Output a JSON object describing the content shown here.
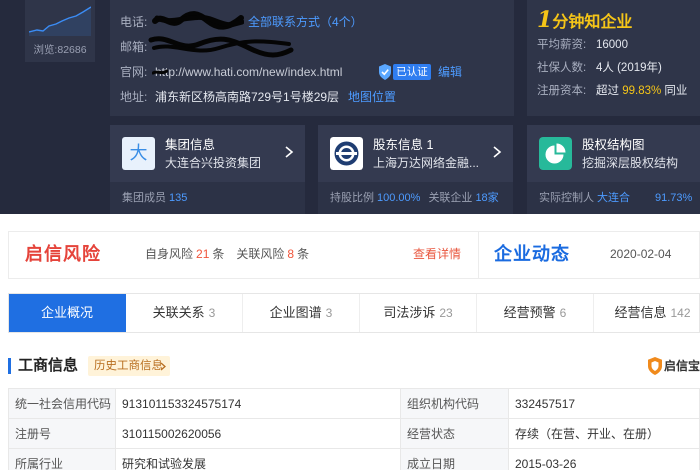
{
  "views": {
    "label": "浏览:",
    "count": "82686"
  },
  "contact": {
    "phone_label": "电话:",
    "all_contacts_link": "全部联系方式（4个）",
    "email_label": "邮箱:",
    "website_label": "官网:",
    "website": "http://www.hati.com/new/index.html",
    "verified_badge": "已认证",
    "edit_link": "编辑",
    "address_label": "地址:",
    "address": "浦东新区杨高南路729号1号楼29层",
    "map_link": "地图位置"
  },
  "quick_profile": {
    "title_number": "1",
    "title_text": "分钟知企业",
    "salary_label": "平均薪资:",
    "salary_value": "16000",
    "insured_label": "社保人数:",
    "insured_value": "4人 (2019年)",
    "capital_label": "注册资本:",
    "capital_prefix": "超过",
    "capital_percent": "99.83%",
    "capital_suffix": "同业"
  },
  "cards": {
    "group": {
      "icon_char": "大",
      "title": "集团信息",
      "subtitle": "大连合兴投资集团",
      "stat_label": "集团成员",
      "stat_value": "135"
    },
    "shareholder": {
      "title": "股东信息",
      "count": "1",
      "subtitle": "上海万达网络金融...",
      "stat1_label": "持股比例",
      "stat1_value": "100.00%",
      "stat2_label": "关联企业",
      "stat2_value": "18家"
    },
    "equity": {
      "title": "股权结构图",
      "subtitle": "挖掘深层股权结构",
      "stat_label": "实际控制人",
      "controller": "大连合",
      "percent": "91.73%"
    }
  },
  "risk": {
    "title": "启信风险",
    "self_label": "自身风险",
    "self_count": "21",
    "related_label": "关联风险",
    "related_count": "8",
    "unit": "条",
    "detail_link": "查看详情"
  },
  "news": {
    "title": "企业动态",
    "date": "2020-02-04"
  },
  "tabs": [
    {
      "label": "企业概况",
      "active": true
    },
    {
      "label": "关联关系",
      "count": "3"
    },
    {
      "label": "企业图谱",
      "count": "3"
    },
    {
      "label": "司法涉诉",
      "count": "23"
    },
    {
      "label": "经营预警",
      "count": "6"
    },
    {
      "label": "经营信息",
      "count": "142"
    }
  ],
  "section": {
    "title": "工商信息",
    "history_link": "历史工商信息"
  },
  "brand": {
    "name": "启信宝"
  },
  "table": {
    "rows": [
      [
        {
          "label": "统一社会信用代码",
          "value": "913101153324575174"
        },
        {
          "label": "组织机构代码",
          "value": "332457517"
        }
      ],
      [
        {
          "label": "注册号",
          "value": "310115002620056"
        },
        {
          "label": "经营状态",
          "value": "存续（在营、开业、在册）"
        }
      ],
      [
        {
          "label": "所属行业",
          "value": "研究和试验发展"
        },
        {
          "label": "成立日期",
          "value": "2015-03-26"
        }
      ]
    ]
  },
  "icons": {
    "views": "trend-sparkline-icon",
    "redaction": "redaction-scribble",
    "verified": "shield-check-icon",
    "card_chevron": "chevron-right-icon",
    "shareholder": "shareholder-logo-icon",
    "equity": "pie-chart-icon",
    "brand": "shield-logo-icon"
  },
  "colors": {
    "header_bg": "#252a3d",
    "panel_bg": "#2f3549",
    "link_blue": "#4d9bff",
    "accent_blue": "#1f6fe2",
    "highlight_yellow": "#f5c518",
    "risk_red": "#e5433a",
    "history_badge_bg": "#fff3d9",
    "equity_icon_green": "#27b99a"
  }
}
